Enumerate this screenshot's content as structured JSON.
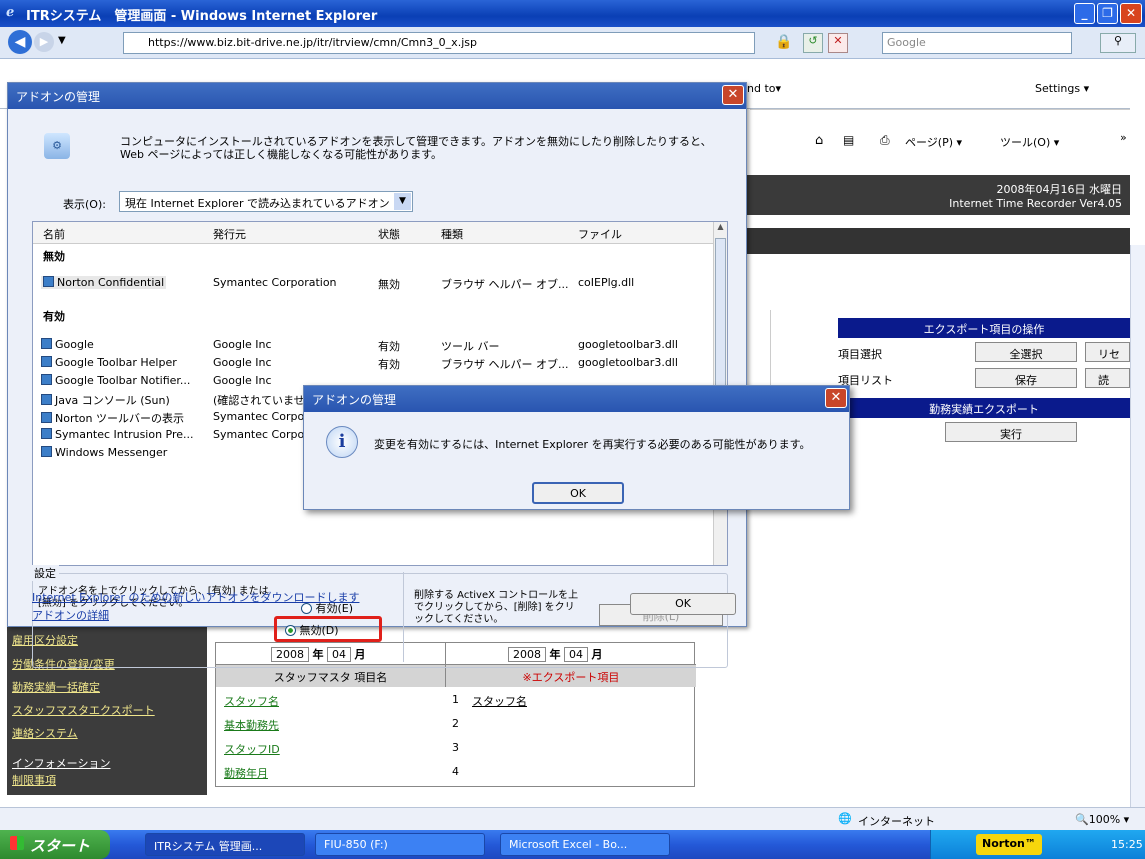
{
  "window": {
    "title": "ITRシステム　管理画面 - Windows Internet Explorer"
  },
  "address": {
    "url": "https://www.biz.bit-drive.ne.jp/itr/itrview/cmn/Cmn3_0_x.jsp",
    "search_placeholder": "Google"
  },
  "toolbar": {
    "send_to": "nd to▾",
    "settings": "Settings ▾",
    "page_menu": "ページ(P) ▾",
    "tools_menu": "ツール(O) ▾"
  },
  "page": {
    "date": "2008年04月16日 水曜日",
    "version": "Internet Time Recorder Ver4.05"
  },
  "export_panel": {
    "header": "エクスポート項目の操作",
    "item_select": "項目選択",
    "select_all": "全選択",
    "reset": "リセ",
    "item_list": "項目リスト",
    "save": "保存",
    "load": "読",
    "section2": "勤務実績エクスポート",
    "run": "実行"
  },
  "nav": {
    "items": [
      "雇用区分設定",
      "労働条件の登録/変更",
      "勤務実績一括確定",
      "スタッフマスタエクスポート",
      "連絡システム"
    ],
    "info_header": "インフォメーション",
    "restrict": "制限事項"
  },
  "table": {
    "year1": "2008",
    "month1": "04",
    "year_label": "年",
    "month_label": "月",
    "year2": "2008",
    "month2": "04",
    "col1": "スタッフマスタ 項目名",
    "col2": "※エクスポート項目",
    "rows": [
      {
        "name": "スタッフ名",
        "num": "1",
        "exp": "スタッフ名"
      },
      {
        "name": "基本勤務先",
        "num": "2",
        "exp": ""
      },
      {
        "name": "スタッフID",
        "num": "3",
        "exp": ""
      },
      {
        "name": "勤務年月",
        "num": "4",
        "exp": ""
      }
    ]
  },
  "addon_dialog": {
    "title": "アドオンの管理",
    "description": "コンピュータにインストールされているアドオンを表示して管理できます。アドオンを無効にしたり削除したりすると、Web ページによっては正しく機能しなくなる可能性があります。",
    "show_label": "表示(O):",
    "show_value": "現在 Internet Explorer で読み込まれているアドオン",
    "columns": [
      "名前",
      "発行元",
      "状態",
      "種類",
      "ファイル"
    ],
    "group_disabled": "無効",
    "group_enabled": "有効",
    "disabled_rows": [
      {
        "name": "Norton Confidential",
        "publisher": "Symantec Corporation",
        "status": "無効",
        "type": "ブラウザ ヘルパー オブ...",
        "file": "coIEPlg.dll"
      }
    ],
    "enabled_rows": [
      {
        "name": "Google",
        "publisher": "Google Inc",
        "status": "有効",
        "type": "ツール バー",
        "file": "googletoolbar3.dll"
      },
      {
        "name": "Google Toolbar Helper",
        "publisher": "Google Inc",
        "status": "有効",
        "type": "ブラウザ ヘルパー オブ...",
        "file": "googletoolbar3.dll"
      },
      {
        "name": "Google Toolbar Notifier...",
        "publisher": "Google Inc",
        "status": "",
        "type": "",
        "file": ""
      },
      {
        "name": "Java コンソール (Sun)",
        "publisher": "(確認されていませ",
        "status": "",
        "type": "",
        "file": ""
      },
      {
        "name": "Norton ツールバーの表示",
        "publisher": "Symantec Corpor",
        "status": "",
        "type": "",
        "file": ""
      },
      {
        "name": "Symantec Intrusion Pre...",
        "publisher": "Symantec Corpor",
        "status": "",
        "type": "",
        "file": ""
      },
      {
        "name": "Windows Messenger",
        "publisher": "",
        "status": "",
        "type": "",
        "file": ""
      }
    ],
    "settings_label": "設定",
    "settings_hint": "アドオン名を上でクリックしてから、[有効] または [無効] をクリックしてください。",
    "enable_radio": "有効(E)",
    "disable_radio": "無効(D)",
    "activex_hint": "削除する ActiveX コントロールを上でクリックしてから、[削除] をクリックしてください。",
    "delete_button": "削除(L)",
    "download_link": "Internet Explorer のための新しいアドオンをダウンロードします",
    "details_link": "アドオンの詳細",
    "ok": "OK"
  },
  "message_box": {
    "title": "アドオンの管理",
    "text": "変更を有効にするには、Internet Explorer を再実行する必要のある可能性があります。",
    "ok": "OK"
  },
  "status": {
    "zone": "インターネット",
    "zoom": "100%"
  },
  "taskbar": {
    "start": "スタート",
    "tasks": [
      "ITRシステム 管理画...",
      "FIU-850 (F:)",
      "Microsoft Excel - Bo..."
    ],
    "norton": "Norton™",
    "time": "15:25"
  }
}
